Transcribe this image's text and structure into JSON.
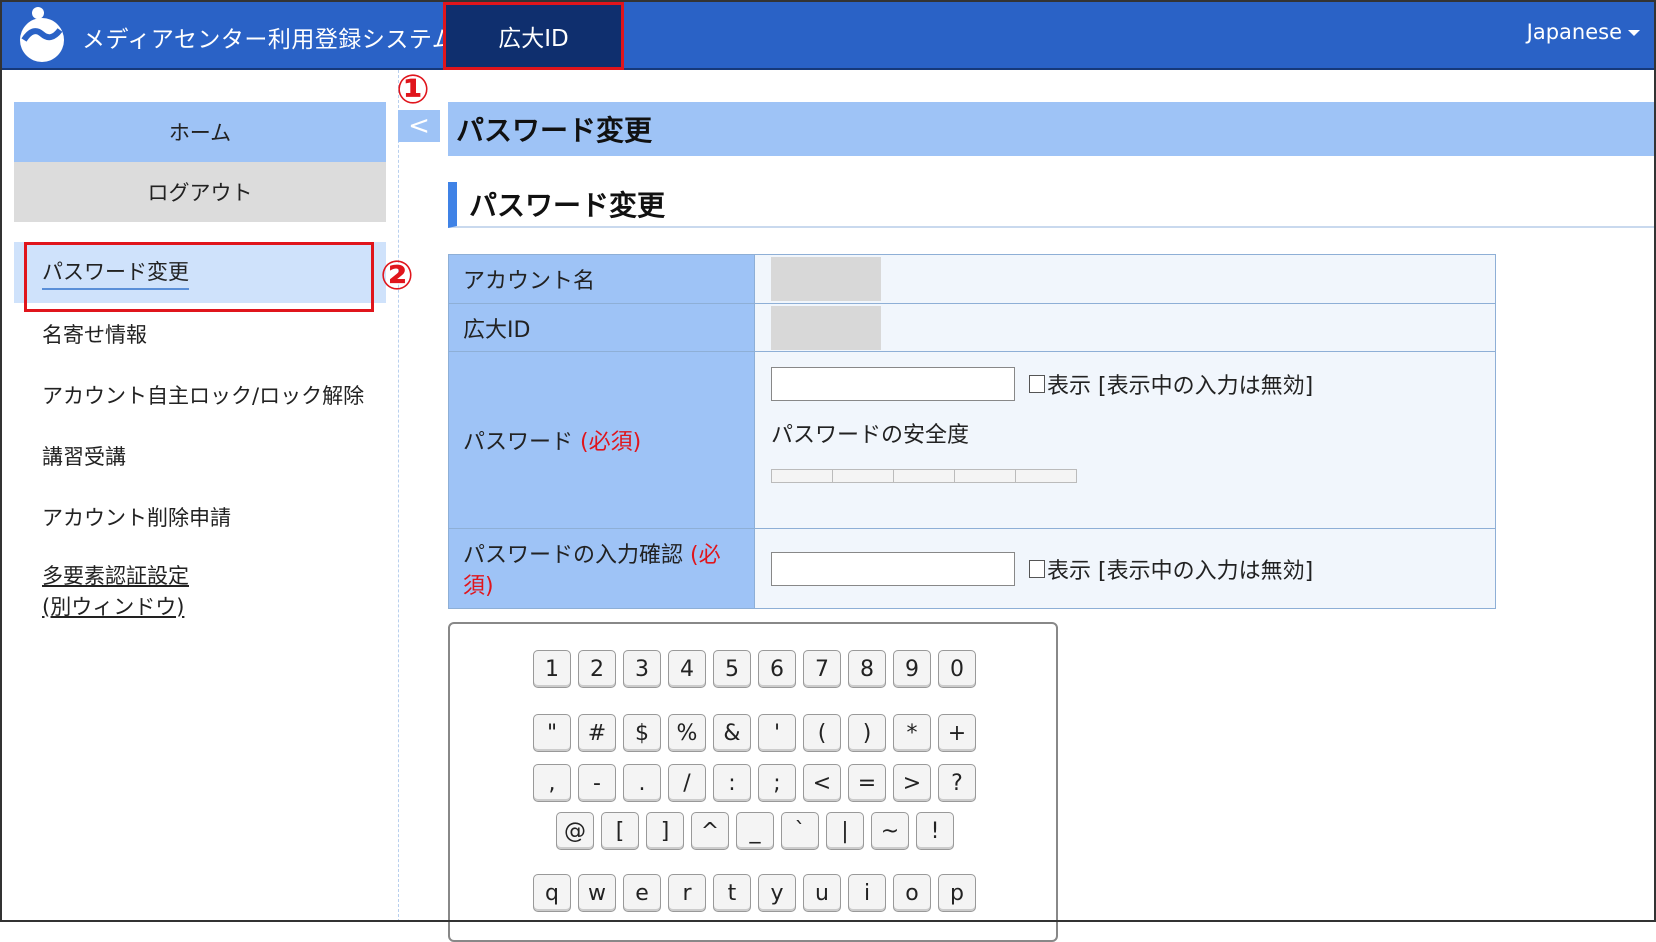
{
  "header": {
    "app_title": "メディアセンター利用登録システム",
    "nav_tab": "広大ID",
    "language": "Japanese"
  },
  "sidebar": {
    "home": "ホーム",
    "logout": "ログアウト",
    "items": [
      {
        "label": "パスワード変更"
      },
      {
        "label": "名寄せ情報"
      },
      {
        "label": "アカウント自主ロック/ロック解除"
      },
      {
        "label": "講習受講"
      },
      {
        "label": "アカウント削除申請"
      },
      {
        "label_line1": "多要素認証設定",
        "label_line2": "(別ウィンドウ)"
      }
    ]
  },
  "callouts": {
    "one": "①",
    "two": "②"
  },
  "collapse_icon": "<",
  "main": {
    "page_title": "パスワード変更",
    "section_title": "パスワード変更",
    "form": {
      "account_name_label": "アカウント名",
      "hiroshima_id_label": "広大ID",
      "password_label": "パスワード",
      "required": "(必須)",
      "show_label": "表示 [表示中の入力は無効]",
      "strength_label": "パスワードの安全度",
      "confirm_label": "パスワードの入力確認",
      "confirm_required_1": "(必",
      "confirm_required_2": "須)"
    }
  },
  "keyboard": {
    "row1": [
      "1",
      "2",
      "3",
      "4",
      "5",
      "6",
      "7",
      "8",
      "9",
      "0"
    ],
    "row2": [
      "\"",
      "#",
      "$",
      "%",
      "&",
      "'",
      "(",
      ")",
      "*",
      "+"
    ],
    "row3": [
      ",",
      "-",
      ".",
      "/",
      ":",
      ";",
      "<",
      "=",
      ">",
      "?"
    ],
    "row4": [
      "@",
      "[",
      "]",
      "^",
      "_",
      "`",
      "|",
      "~",
      "!"
    ],
    "row5": [
      "q",
      "w",
      "e",
      "r",
      "t",
      "y",
      "u",
      "i",
      "o",
      "p"
    ]
  },
  "colors": {
    "header_bg": "#2a62c6",
    "nav_active_bg": "#0f2f6e",
    "highlight_red": "#e0151c",
    "label_bg": "#9ec3f6",
    "accent_blue": "#3f82e6"
  }
}
